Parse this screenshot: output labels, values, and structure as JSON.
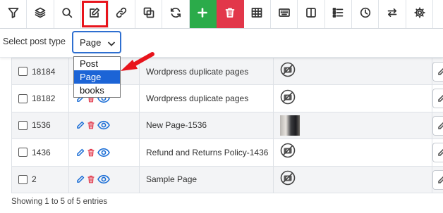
{
  "toolbar": {
    "buttons": [
      {
        "name": "filter-icon"
      },
      {
        "name": "layers-icon"
      },
      {
        "name": "search-icon"
      },
      {
        "name": "edit-icon"
      },
      {
        "name": "link-icon"
      },
      {
        "name": "duplicate-icon"
      },
      {
        "name": "refresh-icon"
      },
      {
        "name": "plus-icon"
      },
      {
        "name": "trash-icon"
      },
      {
        "name": "table-icon"
      },
      {
        "name": "keyboard-icon"
      },
      {
        "name": "columns-icon"
      },
      {
        "name": "list-icon"
      },
      {
        "name": "clock-icon"
      },
      {
        "name": "swap-icon"
      },
      {
        "name": "gear-icon"
      }
    ],
    "add_color": "#2bab4a",
    "delete_color": "#e2374a",
    "highlight_color": "#e8141c"
  },
  "post_type": {
    "label": "Select post type",
    "selected": "Page",
    "options": [
      "Post",
      "Page",
      "books"
    ]
  },
  "table": {
    "rows": [
      {
        "id": "18184",
        "title": "Wordpress duplicate pages",
        "image": "none"
      },
      {
        "id": "18182",
        "title": "Wordpress duplicate pages",
        "image": "none"
      },
      {
        "id": "1536",
        "title": "New Page-1536",
        "image": "thumbnail"
      },
      {
        "id": "1436",
        "title": "Refund and Returns Policy-1436",
        "image": "none"
      },
      {
        "id": "2",
        "title": "Sample Page",
        "image": "none"
      }
    ]
  },
  "footer": {
    "entries_text": "Showing 1 to 5 of 5 entries"
  }
}
